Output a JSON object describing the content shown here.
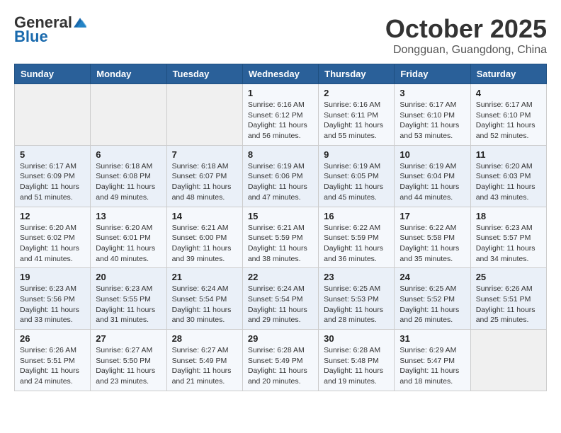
{
  "header": {
    "logo_general": "General",
    "logo_blue": "Blue",
    "month": "October 2025",
    "location": "Dongguan, Guangdong, China"
  },
  "days_of_week": [
    "Sunday",
    "Monday",
    "Tuesday",
    "Wednesday",
    "Thursday",
    "Friday",
    "Saturday"
  ],
  "weeks": [
    [
      {
        "day": "",
        "info": ""
      },
      {
        "day": "",
        "info": ""
      },
      {
        "day": "",
        "info": ""
      },
      {
        "day": "1",
        "info": "Sunrise: 6:16 AM\nSunset: 6:12 PM\nDaylight: 11 hours\nand 56 minutes."
      },
      {
        "day": "2",
        "info": "Sunrise: 6:16 AM\nSunset: 6:11 PM\nDaylight: 11 hours\nand 55 minutes."
      },
      {
        "day": "3",
        "info": "Sunrise: 6:17 AM\nSunset: 6:10 PM\nDaylight: 11 hours\nand 53 minutes."
      },
      {
        "day": "4",
        "info": "Sunrise: 6:17 AM\nSunset: 6:10 PM\nDaylight: 11 hours\nand 52 minutes."
      }
    ],
    [
      {
        "day": "5",
        "info": "Sunrise: 6:17 AM\nSunset: 6:09 PM\nDaylight: 11 hours\nand 51 minutes."
      },
      {
        "day": "6",
        "info": "Sunrise: 6:18 AM\nSunset: 6:08 PM\nDaylight: 11 hours\nand 49 minutes."
      },
      {
        "day": "7",
        "info": "Sunrise: 6:18 AM\nSunset: 6:07 PM\nDaylight: 11 hours\nand 48 minutes."
      },
      {
        "day": "8",
        "info": "Sunrise: 6:19 AM\nSunset: 6:06 PM\nDaylight: 11 hours\nand 47 minutes."
      },
      {
        "day": "9",
        "info": "Sunrise: 6:19 AM\nSunset: 6:05 PM\nDaylight: 11 hours\nand 45 minutes."
      },
      {
        "day": "10",
        "info": "Sunrise: 6:19 AM\nSunset: 6:04 PM\nDaylight: 11 hours\nand 44 minutes."
      },
      {
        "day": "11",
        "info": "Sunrise: 6:20 AM\nSunset: 6:03 PM\nDaylight: 11 hours\nand 43 minutes."
      }
    ],
    [
      {
        "day": "12",
        "info": "Sunrise: 6:20 AM\nSunset: 6:02 PM\nDaylight: 11 hours\nand 41 minutes."
      },
      {
        "day": "13",
        "info": "Sunrise: 6:20 AM\nSunset: 6:01 PM\nDaylight: 11 hours\nand 40 minutes."
      },
      {
        "day": "14",
        "info": "Sunrise: 6:21 AM\nSunset: 6:00 PM\nDaylight: 11 hours\nand 39 minutes."
      },
      {
        "day": "15",
        "info": "Sunrise: 6:21 AM\nSunset: 5:59 PM\nDaylight: 11 hours\nand 38 minutes."
      },
      {
        "day": "16",
        "info": "Sunrise: 6:22 AM\nSunset: 5:59 PM\nDaylight: 11 hours\nand 36 minutes."
      },
      {
        "day": "17",
        "info": "Sunrise: 6:22 AM\nSunset: 5:58 PM\nDaylight: 11 hours\nand 35 minutes."
      },
      {
        "day": "18",
        "info": "Sunrise: 6:23 AM\nSunset: 5:57 PM\nDaylight: 11 hours\nand 34 minutes."
      }
    ],
    [
      {
        "day": "19",
        "info": "Sunrise: 6:23 AM\nSunset: 5:56 PM\nDaylight: 11 hours\nand 33 minutes."
      },
      {
        "day": "20",
        "info": "Sunrise: 6:23 AM\nSunset: 5:55 PM\nDaylight: 11 hours\nand 31 minutes."
      },
      {
        "day": "21",
        "info": "Sunrise: 6:24 AM\nSunset: 5:54 PM\nDaylight: 11 hours\nand 30 minutes."
      },
      {
        "day": "22",
        "info": "Sunrise: 6:24 AM\nSunset: 5:54 PM\nDaylight: 11 hours\nand 29 minutes."
      },
      {
        "day": "23",
        "info": "Sunrise: 6:25 AM\nSunset: 5:53 PM\nDaylight: 11 hours\nand 28 minutes."
      },
      {
        "day": "24",
        "info": "Sunrise: 6:25 AM\nSunset: 5:52 PM\nDaylight: 11 hours\nand 26 minutes."
      },
      {
        "day": "25",
        "info": "Sunrise: 6:26 AM\nSunset: 5:51 PM\nDaylight: 11 hours\nand 25 minutes."
      }
    ],
    [
      {
        "day": "26",
        "info": "Sunrise: 6:26 AM\nSunset: 5:51 PM\nDaylight: 11 hours\nand 24 minutes."
      },
      {
        "day": "27",
        "info": "Sunrise: 6:27 AM\nSunset: 5:50 PM\nDaylight: 11 hours\nand 23 minutes."
      },
      {
        "day": "28",
        "info": "Sunrise: 6:27 AM\nSunset: 5:49 PM\nDaylight: 11 hours\nand 21 minutes."
      },
      {
        "day": "29",
        "info": "Sunrise: 6:28 AM\nSunset: 5:49 PM\nDaylight: 11 hours\nand 20 minutes."
      },
      {
        "day": "30",
        "info": "Sunrise: 6:28 AM\nSunset: 5:48 PM\nDaylight: 11 hours\nand 19 minutes."
      },
      {
        "day": "31",
        "info": "Sunrise: 6:29 AM\nSunset: 5:47 PM\nDaylight: 11 hours\nand 18 minutes."
      },
      {
        "day": "",
        "info": ""
      }
    ]
  ]
}
